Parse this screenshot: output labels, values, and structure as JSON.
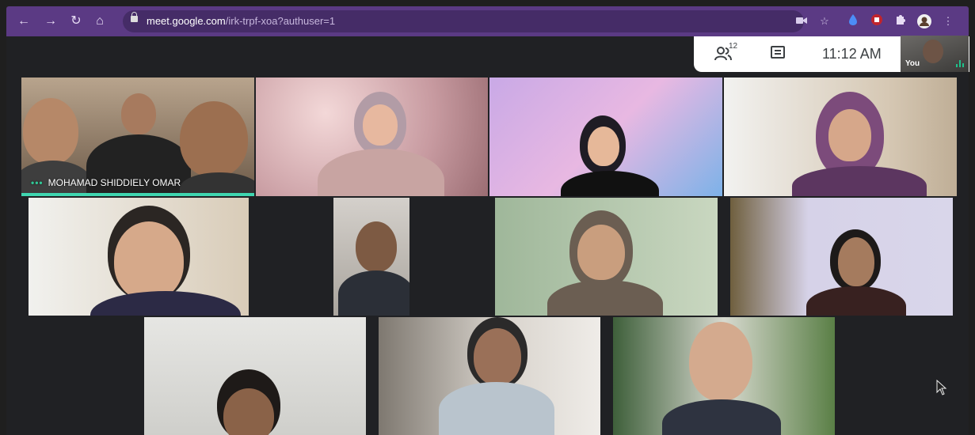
{
  "browser": {
    "url_domain": "meet.google.com",
    "url_path": "/irk-trpf-xoa?authuser=1",
    "nav_icons": [
      "back-icon",
      "forward-icon",
      "reload-icon",
      "home-icon"
    ],
    "extension_icons": [
      "camera-icon",
      "star-icon",
      "extension-blue-icon",
      "ublock-icon",
      "puzzle-icon",
      "profile-avatar-icon",
      "menu-dots-icon"
    ],
    "accent": "#5b3a84"
  },
  "meet": {
    "people_count": "12",
    "time": "11:12 AM",
    "self_label": "You",
    "speaker_name": "MOHAMAD SHIDDIELY OMAR",
    "speaker_dots": "•••",
    "speaking_color": "#3fd6b0"
  }
}
